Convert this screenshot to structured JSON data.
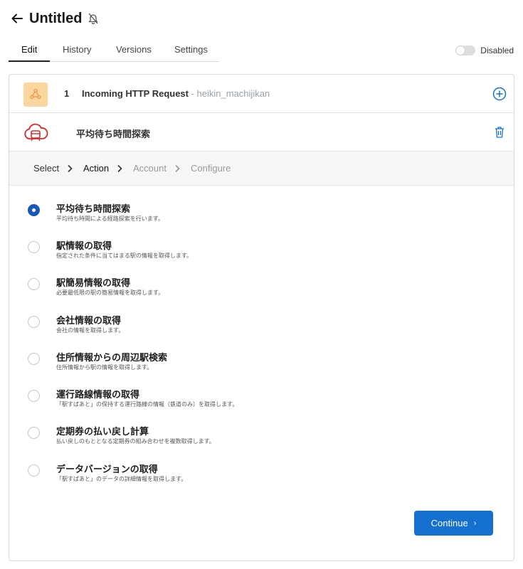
{
  "header": {
    "title": "Untitled"
  },
  "tabs": [
    {
      "label": "Edit",
      "active": true
    },
    {
      "label": "History"
    },
    {
      "label": "Versions"
    },
    {
      "label": "Settings"
    }
  ],
  "toggle": {
    "label": "Disabled",
    "on": false
  },
  "steps": {
    "trigger": {
      "number": "1",
      "title": "Incoming HTTP Request",
      "subtitle": " - heikin_machijikan"
    },
    "action": {
      "title": "平均待ち時間探索"
    }
  },
  "breadcrumb": [
    "Select",
    "Action",
    "Account",
    "Configure"
  ],
  "options": [
    {
      "title": "平均待ち時間探索",
      "desc": "平均待ち時間による経路探索を行います。",
      "selected": true
    },
    {
      "title": "駅情報の取得",
      "desc": "指定された条件に当てはまる駅の情報を取得します。"
    },
    {
      "title": "駅簡易情報の取得",
      "desc": "必要最低限の駅の簡易情報を取得します。"
    },
    {
      "title": "会社情報の取得",
      "desc": "会社の情報を取得します。"
    },
    {
      "title": "住所情報からの周辺駅検索",
      "desc": "住所情報から駅の情報を取得します。"
    },
    {
      "title": "運行路線情報の取得",
      "desc": "「駅すぱあと」の保持する運行路線の情報（鉄道のみ）を取得します。"
    },
    {
      "title": "定期券の払い戻し計算",
      "desc": "払い戻しのもととなる定期券の組み合わせを複数取得します。"
    },
    {
      "title": "データバージョンの取得",
      "desc": "「駅すぱあと」のデータの詳細情報を取得します。"
    }
  ],
  "continue_label": "Continue",
  "colors": {
    "primary": "#1570d0",
    "radio_selected": "#1a57b5",
    "trigger_bg": "#fbd69f",
    "action_icon": "#d42a2a"
  }
}
